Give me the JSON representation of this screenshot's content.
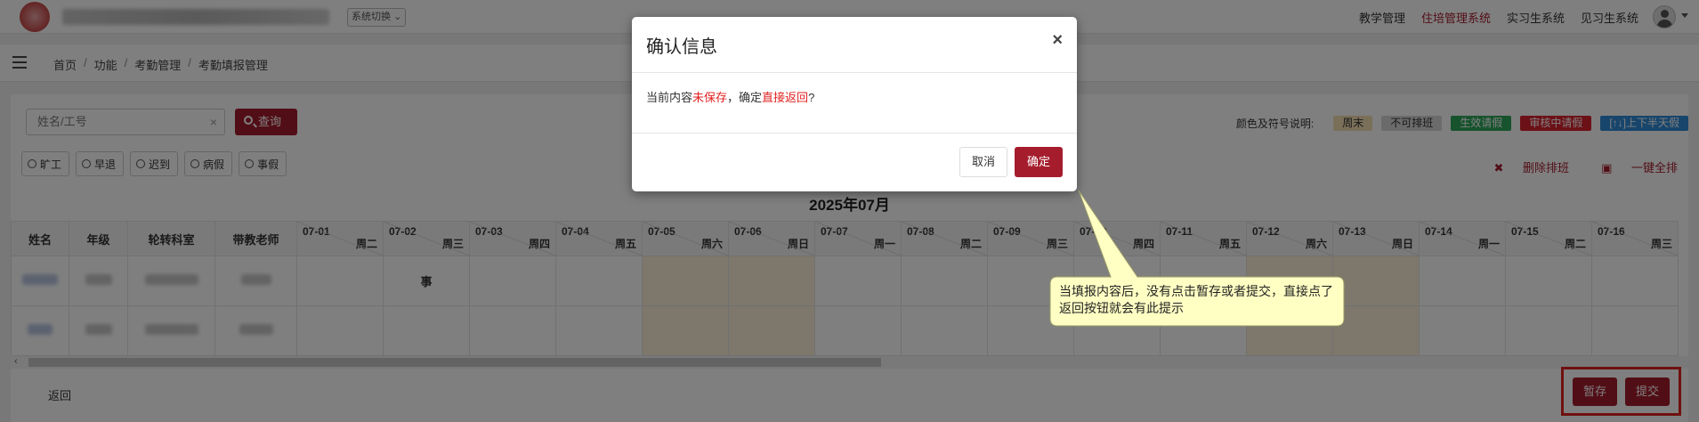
{
  "topbar": {
    "system_switch": "系统切换",
    "nav": [
      "教学管理",
      "住培管理系统",
      "实习生系统",
      "见习生系统"
    ],
    "active_nav": "住培管理系统"
  },
  "breadcrumb": [
    "首页",
    "功能",
    "考勤管理",
    "考勤填报管理"
  ],
  "search": {
    "placeholder": "姓名/工号",
    "clear": "×",
    "query_label": "查询"
  },
  "legend": {
    "label": "颜色及符号说明:",
    "items": [
      "周末",
      "不可排班",
      "生效请假",
      "审核中请假",
      "[↑↓]上下半天假"
    ]
  },
  "status_filters": [
    "旷工",
    "早退",
    "迟到",
    "病假",
    "事假"
  ],
  "actions": {
    "delete_schedule": "删除排班",
    "full_schedule": "一键全排"
  },
  "month_title": "2025年07月",
  "table": {
    "headers": [
      "姓名",
      "年级",
      "轮转科室",
      "带教老师"
    ],
    "days": [
      {
        "date": "07-01",
        "weekday": "周二"
      },
      {
        "date": "07-02",
        "weekday": "周三"
      },
      {
        "date": "07-03",
        "weekday": "周四"
      },
      {
        "date": "07-04",
        "weekday": "周五"
      },
      {
        "date": "07-05",
        "weekday": "周六"
      },
      {
        "date": "07-06",
        "weekday": "周日"
      },
      {
        "date": "07-07",
        "weekday": "周一"
      },
      {
        "date": "07-08",
        "weekday": "周二"
      },
      {
        "date": "07-09",
        "weekday": "周三"
      },
      {
        "date": "07-10",
        "weekday": "周四"
      },
      {
        "date": "07-11",
        "weekday": "周五"
      },
      {
        "date": "07-12",
        "weekday": "周六"
      },
      {
        "date": "07-13",
        "weekday": "周日"
      },
      {
        "date": "07-14",
        "weekday": "周一"
      },
      {
        "date": "07-15",
        "weekday": "周二"
      },
      {
        "date": "07-16",
        "weekday": "周三"
      }
    ],
    "row1_mark": "事"
  },
  "footer": {
    "back_label": "返回",
    "save_draft": "暂存",
    "submit": "提交"
  },
  "modal": {
    "title": "确认信息",
    "close": "×",
    "body_prefix": "当前内容",
    "body_unsaved": "未保存",
    "body_mid": "，确定",
    "body_return": "直接返回",
    "body_suffix": "?",
    "cancel": "取消",
    "confirm": "确定"
  },
  "callout": {
    "text": "当填报内容后，没有点击暂存或者提交，直接点了返回按钮就会有此提示"
  }
}
